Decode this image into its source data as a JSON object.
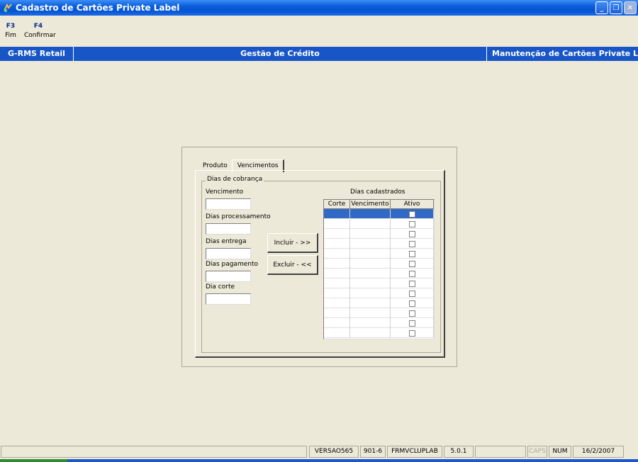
{
  "window": {
    "title": "Cadastro de Cartões Private Label",
    "min": "_",
    "max": "❐",
    "close": "✕"
  },
  "fkeys": [
    {
      "key": "F3",
      "label": "Fim"
    },
    {
      "key": "F4",
      "label": "Confirmar"
    }
  ],
  "header": {
    "app": "G-RMS Retail",
    "module": "Gestão de Crédito",
    "screen": "Manutenção de Cartões Private Label"
  },
  "tabs": {
    "produto": "Produto",
    "vencimentos": "Vencimentos"
  },
  "group": {
    "title": "Dias de cobrança"
  },
  "fields": {
    "vencimento": {
      "label": "Vencimento",
      "value": ""
    },
    "dias_processamento": {
      "label": "Dias processamento",
      "value": ""
    },
    "dias_entrega": {
      "label": "Dias entrega",
      "value": ""
    },
    "dias_pagamento": {
      "label": "Dias pagamento",
      "value": ""
    },
    "dia_corte": {
      "label": "Dia corte",
      "value": ""
    }
  },
  "buttons": {
    "incluir": "Incluir - >>",
    "excluir": "Excluir - <<"
  },
  "grid": {
    "title": "Dias cadastrados",
    "columns": [
      "Corte",
      "Vencimento",
      "Ativo"
    ],
    "rows": 13,
    "selected_row": 0
  },
  "status": {
    "versao": "VERSAO565",
    "code": "901-6",
    "form": "FRMVCLUPLAB",
    "version": "5.0.1",
    "caps": "CAPS",
    "num": "NUM",
    "date": "16/2/2007"
  },
  "colors": {
    "header_bg": "#1856C7",
    "selection": "#316AC5",
    "fkey": "#0A2A8C"
  }
}
